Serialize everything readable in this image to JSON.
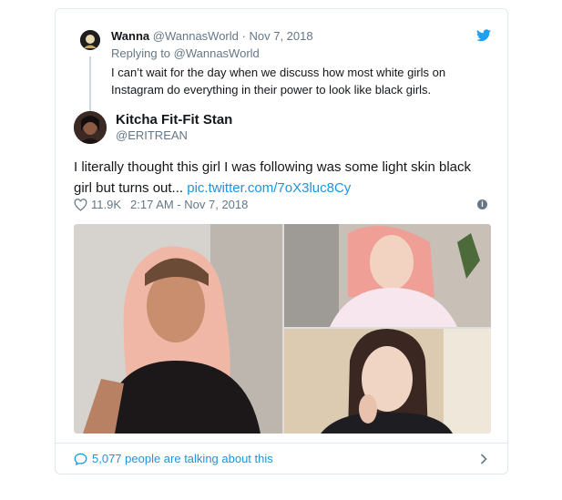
{
  "quoted_tweet": {
    "name": "Wanna",
    "handle": "@WannasWorld",
    "separator": "·",
    "date": "Nov 7, 2018",
    "reply_line": "Replying to @WannasWorld",
    "text": "I can’t wait for the day when we discuss how most white girls on Instagram do everything in their power to look like black girls."
  },
  "tweet": {
    "name": "Kitcha Fit-Fit Stan",
    "handle": "@ERITREAN",
    "text": "I literally thought this girl I was following was some light skin black girl but turns out... ",
    "link": "pic.twitter.com/7oX3luc8Cy",
    "likes": "11.9K",
    "timestamp": "2:17 AM - Nov 7, 2018"
  },
  "footer": {
    "conversation": "5,077 people are talking about this"
  },
  "icons": {
    "brand": "twitter-bird-icon",
    "like": "heart-icon",
    "info": "info-icon",
    "reply": "speech-bubble-icon",
    "more": "chevron-right-icon"
  },
  "colors": {
    "link": "#1b95e0",
    "muted": "#657786",
    "border": "#e1e8ed",
    "text": "#14171a",
    "brand": "#1da1f2"
  }
}
